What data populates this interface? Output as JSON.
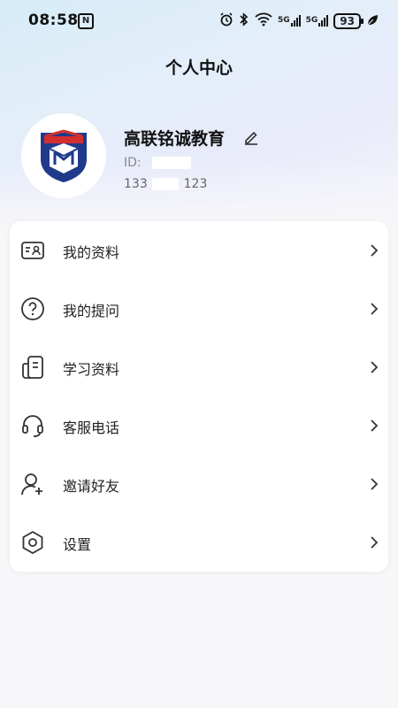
{
  "status_bar": {
    "time": "08:58",
    "nfc_label": "N",
    "signal1_label": "5G",
    "signal2_label": "5G",
    "battery": "93"
  },
  "header": {
    "title": "个人中心"
  },
  "profile": {
    "name": "高联铭诚教育",
    "id_label": "ID:",
    "phone_prefix": "133",
    "phone_suffix": "123"
  },
  "menu": [
    {
      "label": "我的资料",
      "icon": "id-card-icon"
    },
    {
      "label": "我的提问",
      "icon": "question-icon"
    },
    {
      "label": "学习资料",
      "icon": "document-icon"
    },
    {
      "label": "客服电话",
      "icon": "headset-icon"
    },
    {
      "label": "邀请好友",
      "icon": "add-user-icon"
    },
    {
      "label": "设置",
      "icon": "settings-hexagon-icon"
    }
  ],
  "colors": {
    "logo_blue": "#1f3a8a",
    "logo_red": "#d32f2f",
    "icon_stroke": "#333333"
  }
}
